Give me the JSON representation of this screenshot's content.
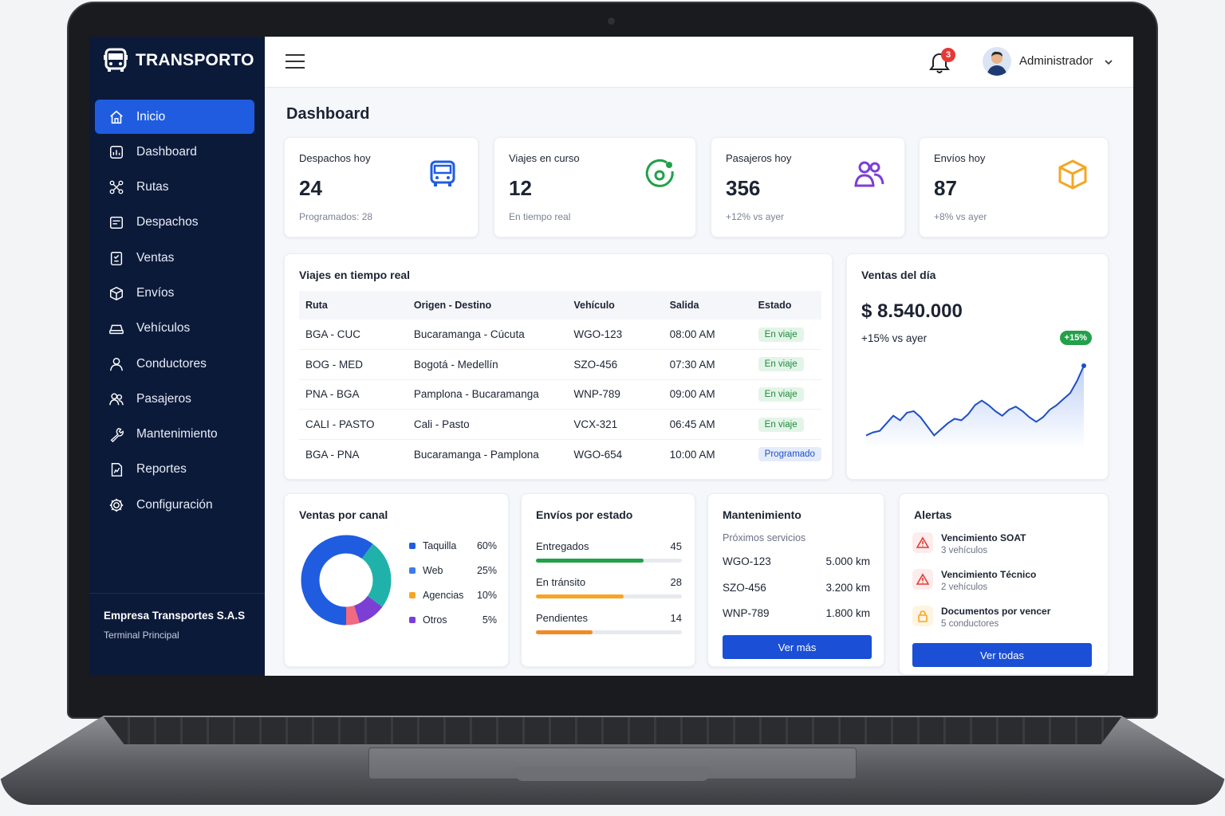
{
  "brand": {
    "name": "TRANSPORTO"
  },
  "sidebar": {
    "items": [
      {
        "label": "Inicio",
        "icon": "home-icon",
        "active": true
      },
      {
        "label": "Dashboard",
        "icon": "dashboard-icon"
      },
      {
        "label": "Rutas",
        "icon": "route-icon"
      },
      {
        "label": "Despachos",
        "icon": "dispatch-icon"
      },
      {
        "label": "Ventas",
        "icon": "sales-icon"
      },
      {
        "label": "Envíos",
        "icon": "package-icon"
      },
      {
        "label": "Vehículos",
        "icon": "vehicle-icon"
      },
      {
        "label": "Conductores",
        "icon": "driver-icon"
      },
      {
        "label": "Pasajeros",
        "icon": "passengers-icon"
      },
      {
        "label": "Mantenimiento",
        "icon": "wrench-icon"
      },
      {
        "label": "Reportes",
        "icon": "report-icon"
      },
      {
        "label": "Configuración",
        "icon": "gear-icon"
      }
    ],
    "footer": {
      "company": "Empresa Transportes S.A.S",
      "terminal": "Terminal Principal"
    }
  },
  "topbar": {
    "notifications": "3",
    "user": "Administrador"
  },
  "page": {
    "title": "Dashboard"
  },
  "kpis": [
    {
      "label": "Despachos hoy",
      "value": "24",
      "sub": "Programados: 28",
      "icon": "bus-icon",
      "color": "#1f5ce0"
    },
    {
      "label": "Viajes en curso",
      "value": "12",
      "sub": "En tiempo real",
      "icon": "location-icon",
      "color": "#22a04a"
    },
    {
      "label": "Pasajeros hoy",
      "value": "356",
      "sub": "+12% vs ayer",
      "icon": "users-icon",
      "color": "#7b3fd4"
    },
    {
      "label": "Envíos hoy",
      "value": "87",
      "sub": "+8% vs ayer",
      "icon": "box-icon",
      "color": "#f5a623"
    }
  ],
  "trips": {
    "title": "Viajes en tiempo real",
    "columns": [
      "Ruta",
      "Origen - Destino",
      "Vehículo",
      "Salida",
      "Estado"
    ],
    "rows": [
      [
        "BGA - CUC",
        "Bucaramanga - Cúcuta",
        "WGO-123",
        "08:00 AM",
        "En viaje"
      ],
      [
        "BOG - MED",
        "Bogotá - Medellín",
        "SZO-456",
        "07:30 AM",
        "En viaje"
      ],
      [
        "PNA - BGA",
        "Pamplona - Bucaramanga",
        "WNP-789",
        "09:00 AM",
        "En viaje"
      ],
      [
        "CALI - PASTO",
        "Cali - Pasto",
        "VCX-321",
        "06:45 AM",
        "En viaje"
      ],
      [
        "BGA - PNA",
        "Bucaramanga - Pamplona",
        "WGO-654",
        "10:00 AM",
        "Programado"
      ]
    ]
  },
  "sales_day": {
    "title": "Ventas del día",
    "amount": "$ 8.540.000",
    "vs": "+15% vs ayer",
    "pill": "+15%",
    "trend": [
      3,
      4,
      4.5,
      7,
      9.5,
      8,
      10.5,
      11,
      9,
      6,
      3,
      5,
      7,
      8.5,
      8,
      10,
      13,
      14.5,
      13,
      11,
      9.5,
      11.5,
      12.5,
      11,
      9,
      7.5,
      9,
      11.5,
      13,
      15,
      17,
      21,
      26
    ]
  },
  "channels": {
    "title": "Ventas por canal",
    "items": [
      {
        "label": "Taquilla",
        "pct": "60%",
        "value": 60,
        "color": "#1f5ce0"
      },
      {
        "label": "Web",
        "pct": "25%",
        "value": 25,
        "color": "#20b2aa"
      },
      {
        "label": "Agencias",
        "pct": "10%",
        "value": 10,
        "color": "#7b3fd4"
      },
      {
        "label": "Otros",
        "pct": "5%",
        "value": 5,
        "color": "#f06a80"
      }
    ],
    "legend_colors": [
      "#1f5ce0",
      "#3b7ee8",
      "#f5a623",
      "#7b3fd4"
    ]
  },
  "shipments": {
    "title": "Envíos por estado",
    "items": [
      {
        "label": "Entregados",
        "value": "45",
        "fraction": 0.74,
        "color": "#22a04a"
      },
      {
        "label": "En tránsito",
        "value": "28",
        "fraction": 0.6,
        "color": "#f5a623"
      },
      {
        "label": "Pendientes",
        "value": "14",
        "fraction": 0.39,
        "color": "#f08a24"
      }
    ]
  },
  "maintenance": {
    "title": "Mantenimiento",
    "subtitle": "Próximos servicios",
    "items": [
      {
        "vehicle": "WGO-123",
        "km": "5.000 km"
      },
      {
        "vehicle": "SZO-456",
        "km": "3.200 km"
      },
      {
        "vehicle": "WNP-789",
        "km": "1.800 km"
      }
    ],
    "button": "Ver más"
  },
  "alerts": {
    "title": "Alertas",
    "items": [
      {
        "title": "Vencimiento SOAT",
        "sub": "3 vehículos",
        "icon": "warning-icon",
        "color": "#e53935"
      },
      {
        "title": "Vencimiento Técnico",
        "sub": "2 vehículos",
        "icon": "warning-icon",
        "color": "#e53935"
      },
      {
        "title": "Documentos por vencer",
        "sub": "5 conductores",
        "icon": "lock-icon",
        "color": "#f5a623"
      }
    ],
    "button": "Ver todas"
  }
}
